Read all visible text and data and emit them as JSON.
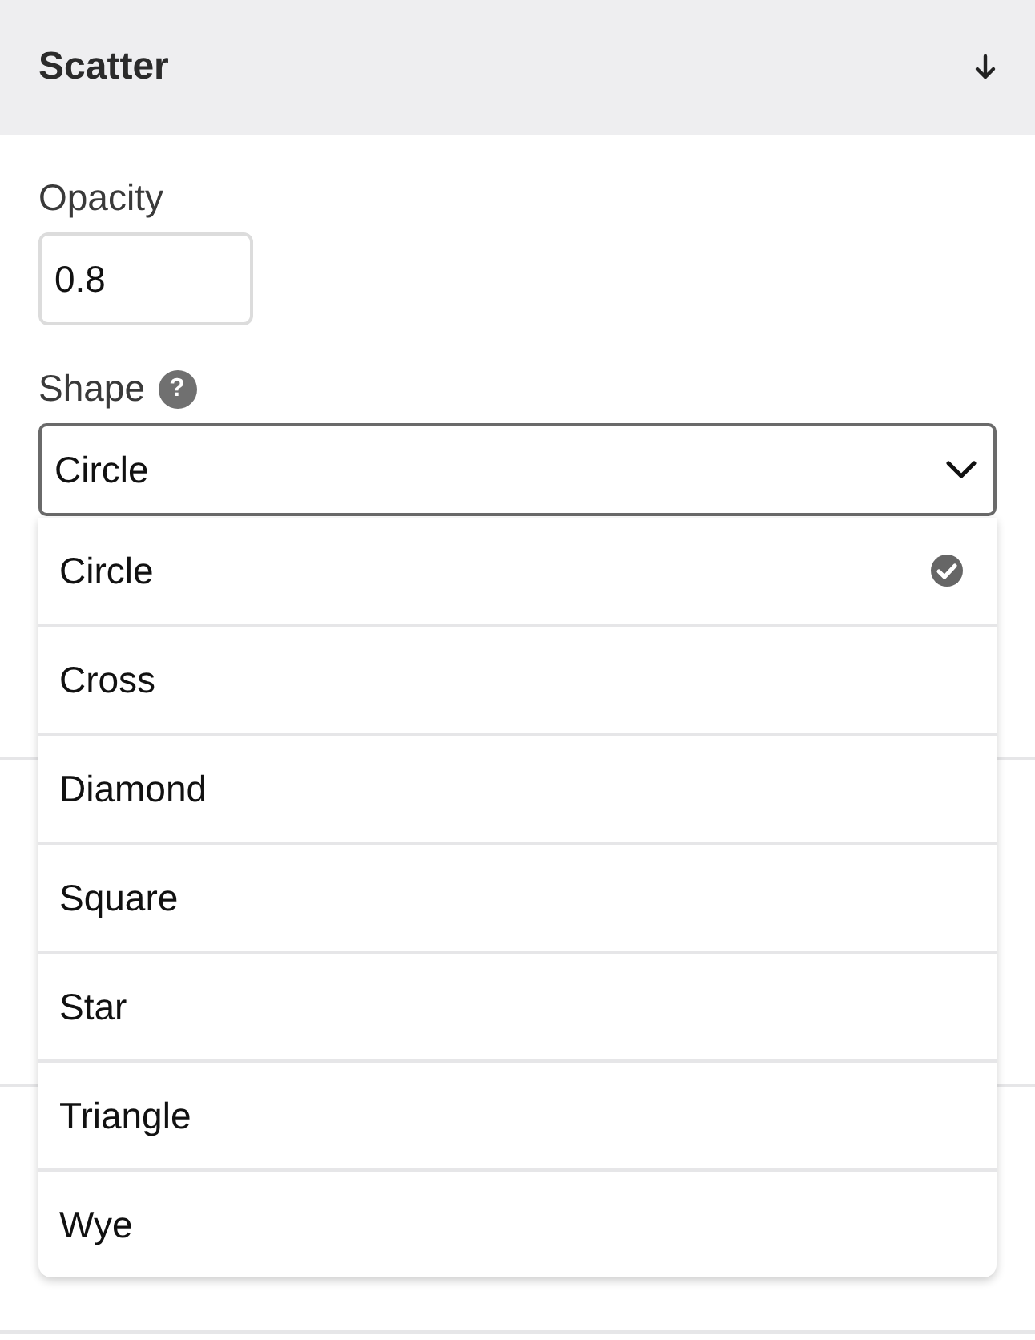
{
  "header": {
    "title": "Scatter"
  },
  "opacity": {
    "label": "Opacity",
    "value": "0.8"
  },
  "shape": {
    "label": "Shape",
    "help": "?",
    "value": "Circle",
    "expanded": true,
    "options": [
      {
        "label": "Circle",
        "selected": true
      },
      {
        "label": "Cross",
        "selected": false
      },
      {
        "label": "Diamond",
        "selected": false
      },
      {
        "label": "Square",
        "selected": false
      },
      {
        "label": "Star",
        "selected": false
      },
      {
        "label": "Triangle",
        "selected": false
      },
      {
        "label": "Wye",
        "selected": false
      }
    ]
  }
}
